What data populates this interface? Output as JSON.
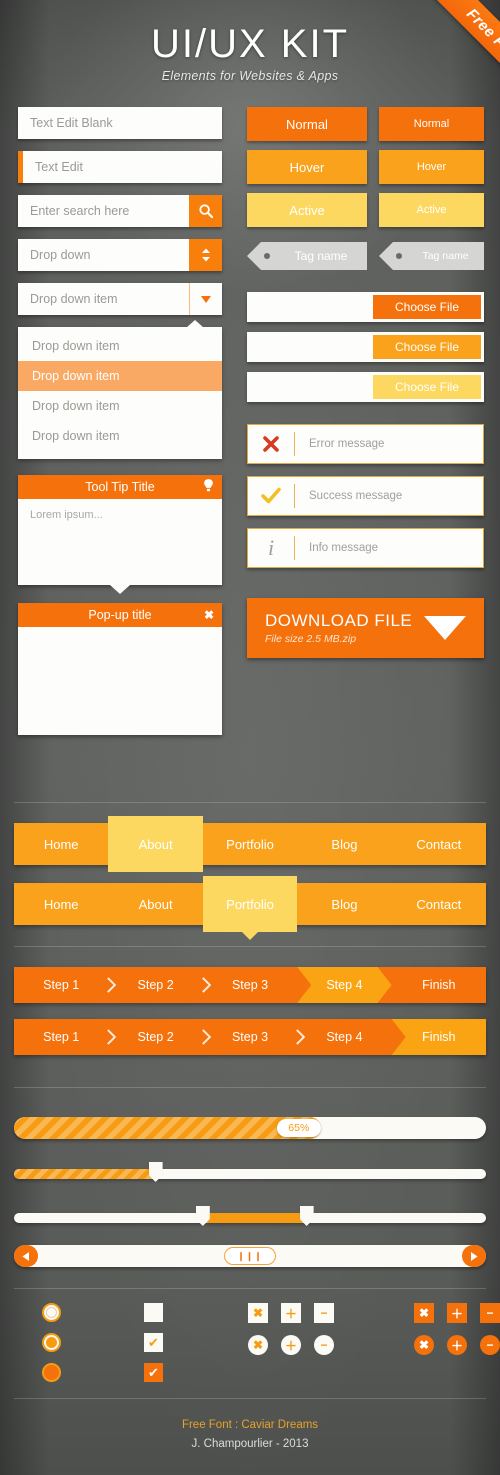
{
  "ribbon": {
    "label": "Free PSD"
  },
  "header": {
    "title": "UI/UX KIT",
    "subtitle": "Elements for Websites & Apps"
  },
  "colors": {
    "normal": "#F4710C",
    "hover": "#FAA21B",
    "active": "#FCD860",
    "highlight": "#F9A964",
    "tag": "#D5D5D3",
    "error": "#D63B22",
    "success": "#F2C020",
    "info": "#A0A09C",
    "background": "#5C5E5C"
  },
  "inputs": {
    "text_blank": {
      "value": "Text Edit Blank"
    },
    "text_focus": {
      "value": "Text Edit"
    },
    "search": {
      "placeholder": "Enter search here",
      "icon": "search-icon"
    },
    "dropdown": {
      "value": "Drop down",
      "icon": "updown-arrows-icon"
    },
    "dropdown_item": {
      "value": "Drop down item",
      "icon": "chevron-down-icon"
    }
  },
  "dropdown_list": {
    "items": [
      {
        "label": "Drop down item",
        "selected": false
      },
      {
        "label": "Drop down item",
        "selected": true
      },
      {
        "label": "Drop down item",
        "selected": false
      },
      {
        "label": "Drop down item",
        "selected": false
      }
    ]
  },
  "tooltip": {
    "title": "Tool Tip Title",
    "icon": "lightbulb-icon",
    "body": "Lorem ipsum..."
  },
  "popup": {
    "title": "Pop-up title",
    "close_label": "✖"
  },
  "buttons": {
    "large": [
      {
        "label": "Normal",
        "state": "normal"
      },
      {
        "label": "Hover",
        "state": "hover"
      },
      {
        "label": "Active",
        "state": "active"
      }
    ],
    "small": [
      {
        "label": "Normal",
        "state": "normal"
      },
      {
        "label": "Hover",
        "state": "hover"
      },
      {
        "label": "Active",
        "state": "active"
      }
    ]
  },
  "tags": [
    {
      "label": "Tag name"
    },
    {
      "label": "Tag name"
    }
  ],
  "file_inputs": [
    {
      "button_label": "Choose File",
      "state": "normal"
    },
    {
      "button_label": "Choose File",
      "state": "hover"
    },
    {
      "button_label": "Choose File",
      "state": "active"
    }
  ],
  "messages": [
    {
      "text": "Error message",
      "icon": "cross-icon",
      "type": "error"
    },
    {
      "text": "Success message",
      "icon": "check-icon",
      "type": "success"
    },
    {
      "text": "Info message",
      "icon": "info-icon",
      "type": "info"
    }
  ],
  "download": {
    "title": "DOWNLOAD FILE",
    "subtitle": "File size 2.5 MB.zip",
    "icon": "download-arrow-icon"
  },
  "nav_bars": [
    {
      "items": [
        {
          "label": "Home",
          "active": false
        },
        {
          "label": "About",
          "active": true
        },
        {
          "label": "Portfolio",
          "active": false
        },
        {
          "label": "Blog",
          "active": false
        },
        {
          "label": "Contact",
          "active": false
        }
      ],
      "pointer": false
    },
    {
      "items": [
        {
          "label": "Home",
          "active": false
        },
        {
          "label": "About",
          "active": false
        },
        {
          "label": "Portfolio",
          "active": true
        },
        {
          "label": "Blog",
          "active": false
        },
        {
          "label": "Contact",
          "active": false
        }
      ],
      "pointer": true
    }
  ],
  "step_bars": [
    {
      "items": [
        {
          "label": "Step 1",
          "active": false
        },
        {
          "label": "Step 2",
          "active": false
        },
        {
          "label": "Step 3",
          "active": false
        },
        {
          "label": "Step 4",
          "active": true
        },
        {
          "label": "Finish",
          "active": false
        }
      ]
    },
    {
      "items": [
        {
          "label": "Step 1",
          "active": false
        },
        {
          "label": "Step 2",
          "active": false
        },
        {
          "label": "Step 3",
          "active": false
        },
        {
          "label": "Step 4",
          "active": false
        },
        {
          "label": "Finish",
          "active": true
        }
      ]
    }
  ],
  "progress": {
    "percent_label": "65%",
    "percent": 65
  },
  "sliders": [
    {
      "type": "single",
      "value": 30
    },
    {
      "type": "range",
      "from": 40,
      "to": 62
    }
  ],
  "scrollbar": {
    "left_icon": "arrow-left-icon",
    "right_icon": "arrow-right-icon",
    "grip_label": "❙❙❙"
  },
  "radios": [
    {
      "state": "empty"
    },
    {
      "state": "dot"
    },
    {
      "state": "filled"
    }
  ],
  "checkboxes": [
    {
      "state": "empty",
      "mark": ""
    },
    {
      "state": "checked",
      "mark": "✔"
    },
    {
      "state": "filled",
      "mark": "✔"
    }
  ],
  "action_icons": {
    "outline": [
      {
        "label": "✖",
        "name": "close-icon",
        "shape": "square"
      },
      {
        "label": "＋",
        "name": "plus-icon",
        "shape": "square"
      },
      {
        "label": "−",
        "name": "minus-icon",
        "shape": "square"
      },
      {
        "label": "✖",
        "name": "close-icon",
        "shape": "round"
      },
      {
        "label": "＋",
        "name": "plus-icon",
        "shape": "round"
      },
      {
        "label": "−",
        "name": "minus-icon",
        "shape": "round"
      }
    ],
    "solid": [
      {
        "label": "✖",
        "name": "close-icon",
        "shape": "square"
      },
      {
        "label": "＋",
        "name": "plus-icon",
        "shape": "square"
      },
      {
        "label": "−",
        "name": "minus-icon",
        "shape": "square"
      },
      {
        "label": "✖",
        "name": "close-icon",
        "shape": "round"
      },
      {
        "label": "＋",
        "name": "plus-icon",
        "shape": "round"
      },
      {
        "label": "−",
        "name": "minus-icon",
        "shape": "round"
      }
    ]
  },
  "footer": {
    "font_credit": "Free Font : Caviar Dreams",
    "author": "J. Champourlier - 2013"
  }
}
